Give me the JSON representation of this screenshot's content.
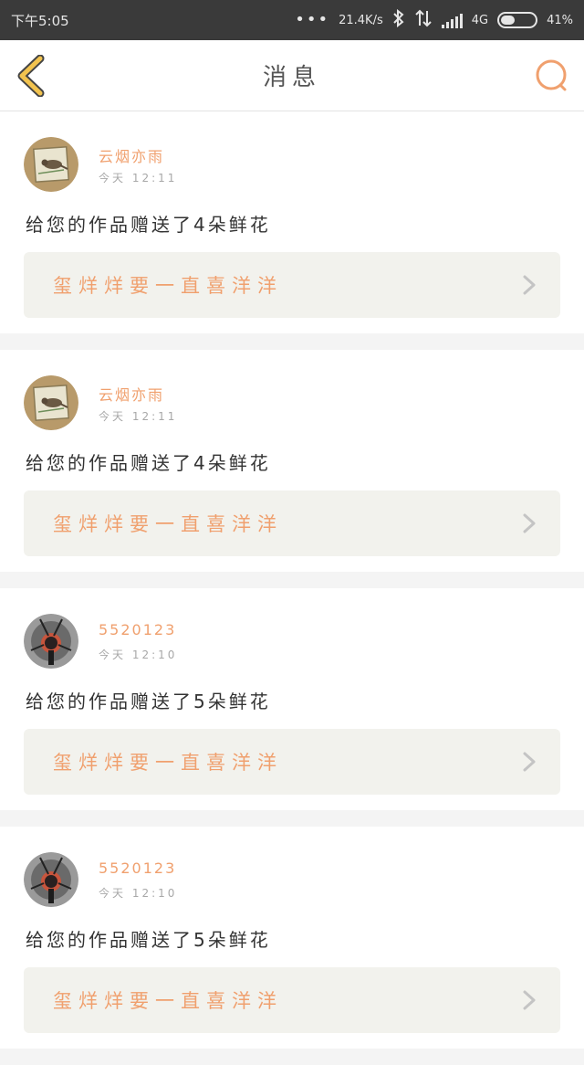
{
  "status_bar": {
    "time": "下午5:05",
    "dots": "•••",
    "network_speed": "21.4K/s",
    "network_type": "4G",
    "battery_percent": "41%",
    "battery_level": 0.41
  },
  "header": {
    "title": "消息"
  },
  "colors": {
    "accent": "#f0a06e",
    "back_arrow": "#f2c34f",
    "card_link_bg": "#f2f2ed"
  },
  "messages": [
    {
      "username": "云烟亦雨",
      "time": "今天 12:11",
      "text": "给您的作品赠送了4朵鲜花",
      "work_title": "玺烊烊要一直喜洋洋",
      "avatar_icon": "bird-icon"
    },
    {
      "username": "云烟亦雨",
      "time": "今天 12:11",
      "text": "给您的作品赠送了4朵鲜花",
      "work_title": "玺烊烊要一直喜洋洋",
      "avatar_icon": "bird-icon"
    },
    {
      "username": "5520123",
      "time": "今天 12:10",
      "text": "给您的作品赠送了5朵鲜花",
      "work_title": "玺烊烊要一直喜洋洋",
      "avatar_icon": "figure-icon"
    },
    {
      "username": "5520123",
      "time": "今天 12:10",
      "text": "给您的作品赠送了5朵鲜花",
      "work_title": "玺烊烊要一直喜洋洋",
      "avatar_icon": "figure-icon"
    }
  ]
}
